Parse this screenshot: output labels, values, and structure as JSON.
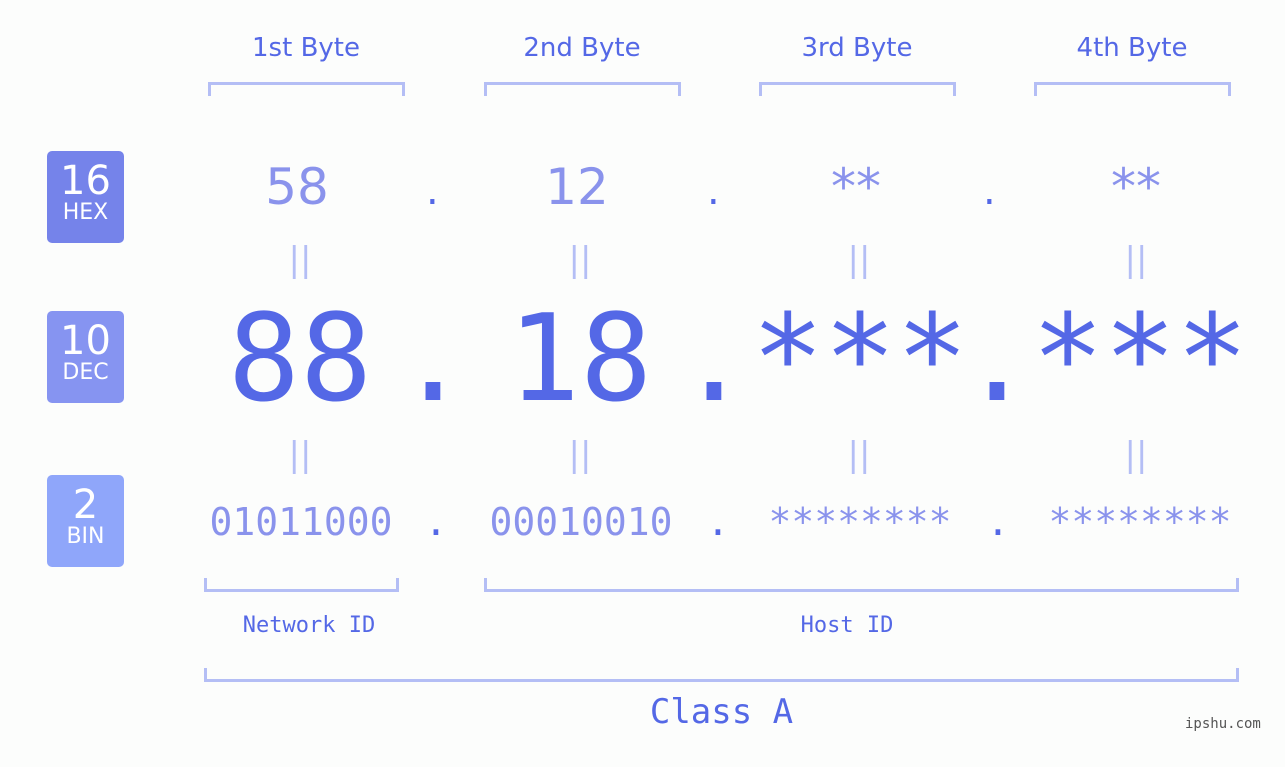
{
  "bytes": {
    "headers": [
      "1st Byte",
      "2nd Byte",
      "3rd Byte",
      "4th Byte"
    ]
  },
  "rows": {
    "hex": {
      "base": "16",
      "label": "HEX",
      "values": [
        "58",
        "12",
        "**",
        "**"
      ],
      "color": "#7583ea"
    },
    "dec": {
      "base": "10",
      "label": "DEC",
      "values": [
        "88",
        "18",
        "***",
        "***"
      ],
      "color": "#8694f1"
    },
    "bin": {
      "base": "2",
      "label": "BIN",
      "values": [
        "01011000",
        "00010010",
        "********",
        "********"
      ],
      "color": "#8fa6fa"
    }
  },
  "separator": ".",
  "equals": "||",
  "labels": {
    "network_id": "Network ID",
    "host_id": "Host ID",
    "class": "Class A"
  },
  "watermark": "ipshu.com",
  "colors": {
    "accent": "#5468e6",
    "light": "#8a93ec",
    "bracket": "#b4bef5"
  }
}
